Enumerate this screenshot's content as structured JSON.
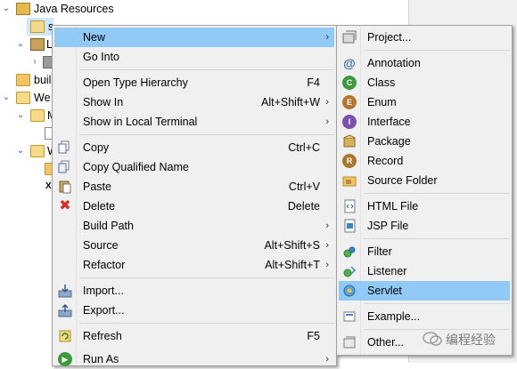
{
  "tree": {
    "rows": [
      {
        "label": "Java Resources"
      },
      {
        "label": "s"
      },
      {
        "label": "L"
      },
      {
        "label": ""
      },
      {
        "label": "buil"
      },
      {
        "label": "We"
      },
      {
        "label": "M"
      },
      {
        "label": ""
      },
      {
        "label": "W"
      },
      {
        "label": ""
      },
      {
        "label": "X"
      }
    ]
  },
  "context_menu": {
    "items": [
      {
        "label": "New",
        "shortcut": "",
        "submenu": true
      },
      {
        "label": "Go Into",
        "shortcut": ""
      },
      {
        "label": "Open Type Hierarchy",
        "shortcut": "F4"
      },
      {
        "label": "Show In",
        "shortcut": "Alt+Shift+W",
        "submenu": true
      },
      {
        "label": "Show in Local Terminal",
        "shortcut": "",
        "submenu": true
      },
      {
        "label": "Copy",
        "shortcut": "Ctrl+C"
      },
      {
        "label": "Copy Qualified Name",
        "shortcut": ""
      },
      {
        "label": "Paste",
        "shortcut": "Ctrl+V"
      },
      {
        "label": "Delete",
        "shortcut": "Delete"
      },
      {
        "label": "Build Path",
        "shortcut": "",
        "submenu": true
      },
      {
        "label": "Source",
        "shortcut": "Alt+Shift+S",
        "submenu": true
      },
      {
        "label": "Refactor",
        "shortcut": "Alt+Shift+T",
        "submenu": true
      },
      {
        "label": "Import...",
        "shortcut": ""
      },
      {
        "label": "Export...",
        "shortcut": ""
      },
      {
        "label": "Refresh",
        "shortcut": "F5"
      },
      {
        "label": "Run As",
        "shortcut": "",
        "submenu": true
      }
    ]
  },
  "new_submenu": {
    "items": [
      {
        "label": "Project..."
      },
      {
        "label": "Annotation"
      },
      {
        "label": "Class"
      },
      {
        "label": "Enum"
      },
      {
        "label": "Interface"
      },
      {
        "label": "Package"
      },
      {
        "label": "Record"
      },
      {
        "label": "Source Folder"
      },
      {
        "label": "HTML File"
      },
      {
        "label": "JSP File"
      },
      {
        "label": "Filter"
      },
      {
        "label": "Listener"
      },
      {
        "label": "Servlet"
      },
      {
        "label": "Example..."
      },
      {
        "label": "Other..."
      }
    ],
    "highlighted": "Servlet"
  },
  "watermark": {
    "text": "编程经验"
  },
  "colors": {
    "menu_bg": "#f0f0f0",
    "highlight": "#91c9f7",
    "selection": "#cce8ff"
  }
}
